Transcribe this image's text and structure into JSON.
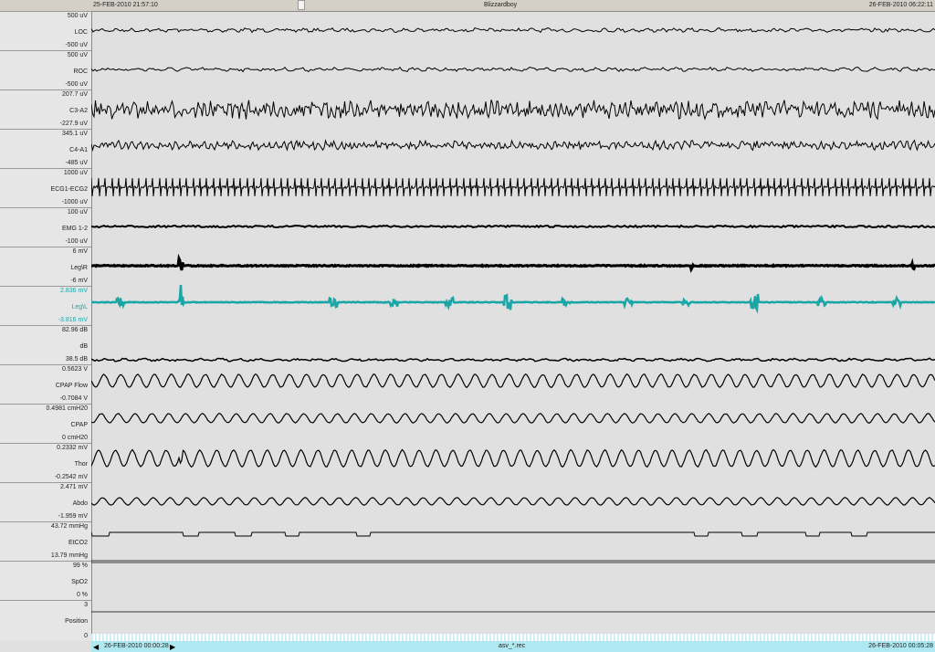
{
  "header": {
    "start_time": "25-FEB-2010 21:57:10",
    "title": "Blizzardboy",
    "end_time": "26-FEB-2010 06:22:11"
  },
  "footer": {
    "window_start": "26-FEB-2010 00:00:28",
    "file_name": "asv_*.rec",
    "window_end": "26-FEB-2010 00:05:28",
    "prev_icon": "arrow-left-icon",
    "next_icon": "arrow-right-icon"
  },
  "colors": {
    "trace": "#000000",
    "leg_l_trace": "#1aa6a6",
    "timebar": "#aee8f0"
  },
  "channels": [
    {
      "name": "LOC",
      "max": "500 uV",
      "min": "-500 uV"
    },
    {
      "name": "ROC",
      "max": "500 uV",
      "min": "-500 uV"
    },
    {
      "name": "C3-A2",
      "max": "207.7 uV",
      "min": "-227.9 uV"
    },
    {
      "name": "C4-A1",
      "max": "345.1 uV",
      "min": "-485 uV"
    },
    {
      "name": "ECG1-ECG2",
      "max": "1000 uV",
      "min": "-1000 uV"
    },
    {
      "name": "EMG 1-2",
      "max": "100 uV",
      "min": "-100 uV"
    },
    {
      "name": "Leg\\R",
      "max": "6 mV",
      "min": "-6 mV"
    },
    {
      "name": "Leg\\L",
      "max": "2.836 mV",
      "min": "-3.816 mV"
    },
    {
      "name": "dB",
      "max": "82.96 dB",
      "min": "38.5 dB"
    },
    {
      "name": "CPAP Flow",
      "max": "0.5623 V",
      "min": "-0.7084 V"
    },
    {
      "name": "CPAP",
      "max": "0.4981 cmH20",
      "min": "0 cmH20"
    },
    {
      "name": "Thor",
      "max": "0.2332 mV",
      "min": "-0.2542 mV"
    },
    {
      "name": "Abdo",
      "max": "2.471 mV",
      "min": "-1.959 mV"
    },
    {
      "name": "EtCO2",
      "max": "43.72 mmHg",
      "min": "13.79 mmHg"
    },
    {
      "name": "SpO2",
      "max": "99 %",
      "min": "0 %"
    },
    {
      "name": "Position",
      "max": "3",
      "min": "0"
    }
  ]
}
